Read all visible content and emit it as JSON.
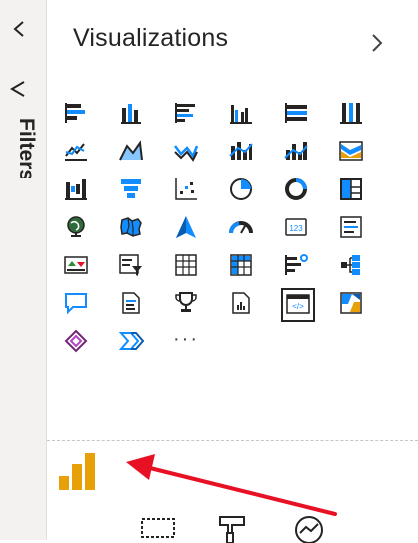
{
  "pane": {
    "title": "Visualizations",
    "filters_label": "Filters"
  },
  "icons": {
    "collapse": "chevron-left-icon",
    "expand": "chevron-right-icon",
    "filter": "filter-icon",
    "more": "more-visuals-ellipsis",
    "custom": "custom-bar-chart-visual-icon"
  },
  "more_label": "···",
  "colors": {
    "accent_blue": "#118dff",
    "dark": "#252423",
    "orange": "#e8a008",
    "arrow_red": "#e81123"
  }
}
